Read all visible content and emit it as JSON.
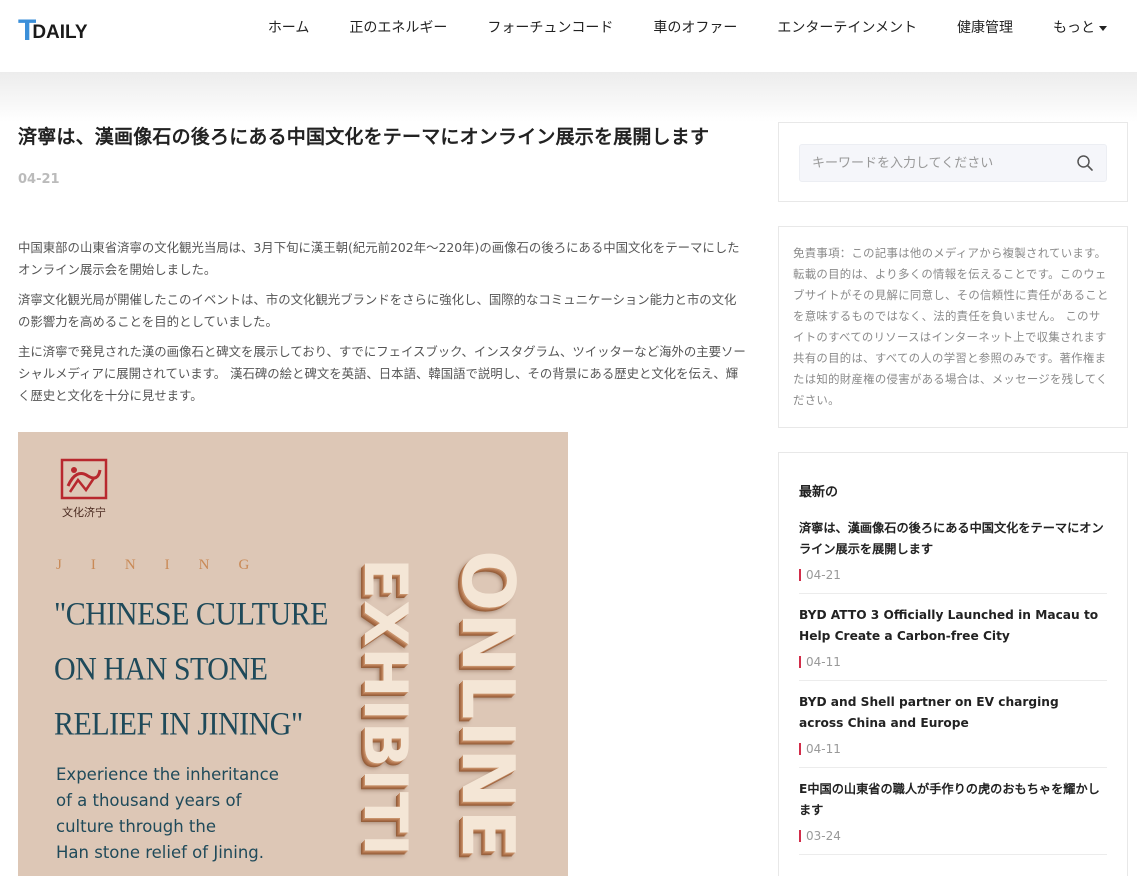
{
  "header": {
    "logo_t": "T",
    "logo_text": "DAILY",
    "nav": [
      "ホーム",
      "正のエネルギー",
      "フォーチュンコード",
      "車のオファー",
      "エンターテインメント",
      "健康管理",
      "もっと"
    ]
  },
  "article": {
    "title": "済寧は、漢画像石の後ろにある中国文化をテーマにオンライン展示を展開します",
    "date": "04-21",
    "paragraphs": [
      "中国東部の山東省済寧の文化観光当局は、3月下旬に漢王朝(紀元前202年〜220年)の画像石の後ろにある中国文化をテーマにしたオンライン展示会を開始しました。",
      "済寧文化観光局が開催したこのイベントは、市の文化観光ブランドをさらに強化し、国際的なコミュニケーション能力と市の文化の影響力を高めることを目的としていました。",
      "主に済寧で発見された漢の画像石と碑文を展示しており、すでにフェイスブック、インスタグラム、ツイッターなど海外の主要ソーシャルメディアに展開されています。 漢石碑の絵と碑文を英語、日本語、韓国語で説明し、その背景にある歴史と文化を伝え、輝く歴史と文化を十分に見せます。"
    ],
    "poster": {
      "logo_caption": "文化济宁",
      "jining": "JINING",
      "heading": [
        "\"CHINESE CULTURE",
        "ON HAN STONE",
        "RELIEF IN JINING\""
      ],
      "body": [
        "Experience the inheritance",
        "of a thousand years of",
        "culture through the",
        "Han stone relief of Jining."
      ],
      "vertical_1": "ONLINE",
      "vertical_2": "EXHIBITI"
    }
  },
  "sidebar": {
    "search_placeholder": "キーワードを入力してください",
    "disclaimer": "免責事項：この記事は他のメディアから複製されています。転載の目的は、より多くの情報を伝えることです。このウェブサイトがその見解に同意し、その信頼性に責任があることを意味するものではなく、法的責任を負いません。 このサイトのすべてのリソースはインターネット上で収集されます共有の目的は、すべての人の学習と参照のみです。著作権または知的財産権の侵害がある場合は、メッセージを残してください。",
    "latest_title": "最新の",
    "latest": [
      {
        "title": "済寧は、漢画像石の後ろにある中国文化をテーマにオンライン展示を展開します",
        "date": "04-21"
      },
      {
        "title": "BYD ATTO 3 Officially Launched in Macau to Help Create a Carbon-free City",
        "date": "04-11"
      },
      {
        "title": "BYD and Shell partner on EV charging across China and Europe",
        "date": "04-11"
      },
      {
        "title": "E中国の山東省の職人が手作りの虎のおもちゃを耀かします",
        "date": "03-24"
      }
    ]
  },
  "colors": {
    "accent_blue": "#3b8fd9",
    "date_bar_red": "#d22d4a",
    "poster_bg": "#ddc7b6",
    "poster_text": "#1f4a5a"
  }
}
